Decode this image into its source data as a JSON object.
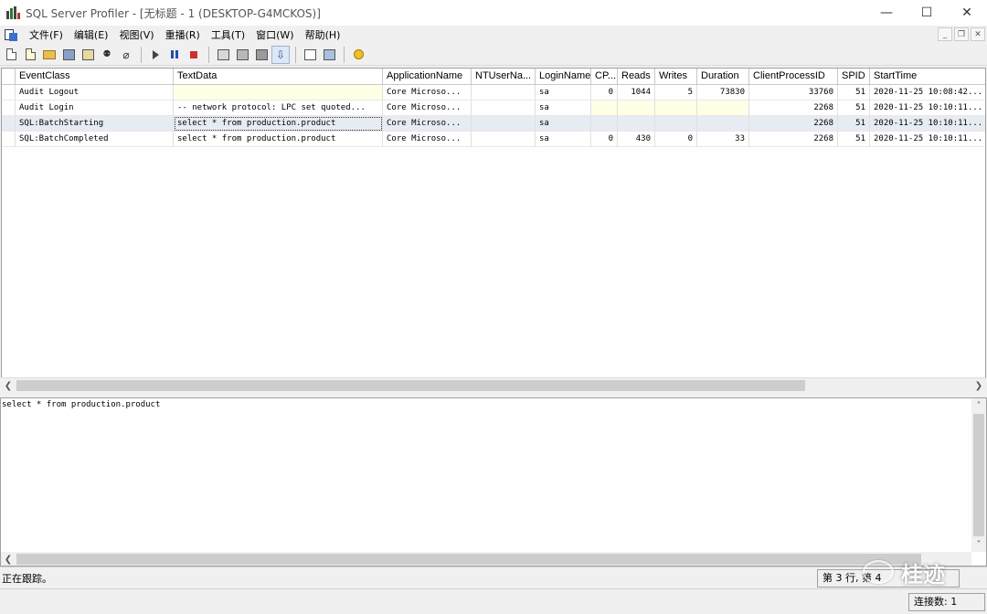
{
  "window": {
    "title": "SQL Server Profiler - [无标题 - 1 (DESKTOP-G4MCKOS)]",
    "minimize": "—",
    "maximize": "☐",
    "close": "✕"
  },
  "menu": {
    "items": [
      "文件(F)",
      "编辑(E)",
      "视图(V)",
      "重播(R)",
      "工具(T)",
      "窗口(W)",
      "帮助(H)"
    ],
    "mdi_minimize": "_",
    "mdi_restore": "❐",
    "mdi_close": "✕"
  },
  "toolbar": {
    "buttons": [
      "new-trace",
      "new-template",
      "open",
      "save",
      "properties",
      "find",
      "clear",
      "run",
      "pause",
      "stop",
      "auto-scroll-1",
      "auto-scroll-2",
      "column-1",
      "auto-scroll-active",
      "aggregate",
      "perfmon",
      "help"
    ]
  },
  "grid": {
    "columns": [
      "EventClass",
      "TextData",
      "ApplicationName",
      "NTUserNa...",
      "LoginName",
      "CP...",
      "Reads",
      "Writes",
      "Duration",
      "ClientProcessID",
      "SPID",
      "StartTime"
    ],
    "rows": [
      [
        "Audit Logout",
        "",
        "Core Microso...",
        "",
        "sa",
        "0",
        "1044",
        "5",
        "73830",
        "33760",
        "51",
        "2020-11-25 10:08:42..."
      ],
      [
        "Audit Login",
        "-- network protocol: LPC  set quoted...",
        "Core Microso...",
        "",
        "sa",
        "",
        "",
        "",
        "",
        "2268",
        "51",
        "2020-11-25 10:10:11..."
      ],
      [
        "SQL:BatchStarting",
        "select * from production.product",
        "Core Microso...",
        "",
        "sa",
        "",
        "",
        "",
        "",
        "2268",
        "51",
        "2020-11-25 10:10:11..."
      ],
      [
        "SQL:BatchCompleted",
        "select * from production.product",
        "Core Microso...",
        "",
        "sa",
        "0",
        "430",
        "0",
        "33",
        "2268",
        "51",
        "2020-11-25 10:10:11..."
      ]
    ],
    "selected_row": 2
  },
  "text_pane": {
    "content": "select * from production.product"
  },
  "status": {
    "left": "正在跟踪。",
    "position": "第 3 行, 第 4",
    "connections": "连接数: 1"
  },
  "watermark": {
    "text": "桂迹"
  }
}
